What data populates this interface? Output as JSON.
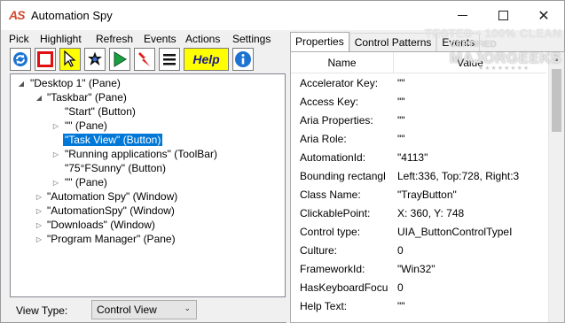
{
  "window": {
    "icon_text": "AS",
    "title": "Automation Spy",
    "controls": {
      "minimize": "minimize",
      "maximize": "maximize",
      "close": "✕"
    }
  },
  "menu": [
    "Pick",
    "Highlight",
    "Refresh",
    "Events",
    "Actions",
    "Settings"
  ],
  "toolbar": {
    "buttons": [
      "refresh-icon",
      "stop-highlight-icon",
      "pick-cursor-icon",
      "event-star-icon",
      "play-icon",
      "lightning-icon",
      "menu-lines-icon"
    ],
    "help_label": "Help",
    "info_icon": "info-icon",
    "colors": {
      "refresh": "#1e73d2",
      "stop": "#e01010",
      "pick": "#ffff00",
      "play": "#1aa040",
      "lightning": "#e0201c",
      "help_bg": "#ffff00"
    }
  },
  "tree": {
    "rows": [
      {
        "label": "\"Desktop 1\" (Pane)",
        "toggle": "◢"
      },
      {
        "label": "\"Taskbar\" (Pane)",
        "toggle": "◢"
      },
      {
        "label": "\"Start\" (Button)",
        "toggle": ""
      },
      {
        "label": "\"\" (Pane)",
        "toggle": "▷"
      },
      {
        "label": "\"Task View\" (Button)",
        "toggle": "",
        "selected": true
      },
      {
        "label": "\"Running applications\" (ToolBar)",
        "toggle": "▷"
      },
      {
        "label": "\"75°FSunny\" (Button)",
        "toggle": ""
      },
      {
        "label": "\"\" (Pane)",
        "toggle": "▷"
      },
      {
        "label": "\"Automation Spy\" (Window)",
        "toggle": "▷"
      },
      {
        "label": "\"AutomationSpy\" (Window)",
        "toggle": "▷"
      },
      {
        "label": "\"Downloads\" (Window)",
        "toggle": "▷"
      },
      {
        "label": "\"Program Manager\" (Pane)",
        "toggle": "▷"
      }
    ]
  },
  "view_type": {
    "label": "View Type:",
    "value": "Control View"
  },
  "tabs": [
    {
      "label": "Properties",
      "active": true
    },
    {
      "label": "Control Patterns",
      "active": false
    },
    {
      "label": "Events",
      "active": false
    }
  ],
  "properties": {
    "header": {
      "name": "Name",
      "value": "Value"
    },
    "rows": [
      {
        "name": "Accelerator Key:",
        "value": "\"\""
      },
      {
        "name": "Access Key:",
        "value": "\"\""
      },
      {
        "name": "Aria Properties:",
        "value": "\"\""
      },
      {
        "name": "Aria Role:",
        "value": "\"\""
      },
      {
        "name": "AutomationId:",
        "value": "\"4113\""
      },
      {
        "name": "Bounding rectangl",
        "value": "Left:336, Top:728, Right:3"
      },
      {
        "name": "Class Name:",
        "value": "\"TrayButton\""
      },
      {
        "name": "ClickablePoint:",
        "value": "X: 360, Y: 748"
      },
      {
        "name": "Control type:",
        "value": "UIA_ButtonControlTypeI"
      },
      {
        "name": "Culture:",
        "value": "0"
      },
      {
        "name": "FrameworkId:",
        "value": "\"Win32\""
      },
      {
        "name": "HasKeyboardFocu",
        "value": "0"
      },
      {
        "name": "Help Text:",
        "value": "\"\""
      }
    ]
  },
  "watermark": {
    "line1": "TESTED • 100% CLEAN",
    "line2": "CERTIFIED",
    "brand": "MAJORGEEKS",
    "stars": "★★★★★★★★"
  }
}
